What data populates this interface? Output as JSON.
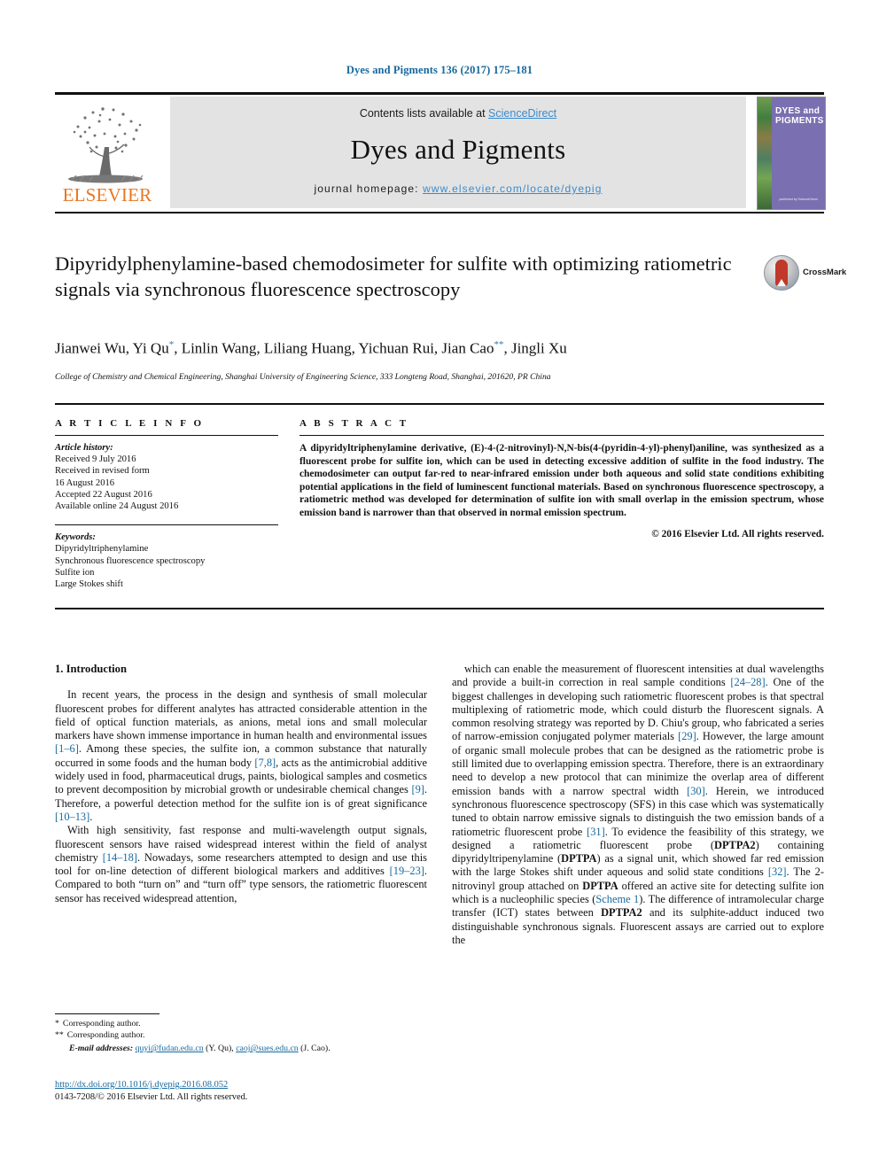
{
  "running_head": "Dyes and Pigments 136 (2017) 175–181",
  "masthead": {
    "contents_prefix": "Contents lists available at ",
    "contents_link": "ScienceDirect",
    "journal_name": "Dyes and Pigments",
    "homepage_prefix": "journal homepage: ",
    "homepage_url": "www.elsevier.com/locate/dyepig",
    "publisher_logo_text": "ELSEVIER",
    "cover_title": "DYES and PIGMENTS",
    "cover_footer": "published by ScienceDirect",
    "colors": {
      "link": "#3a8bcd",
      "elsevier_orange": "#e87722",
      "band_gray": "#e3e3e3",
      "cover_purple": "#7a6fb0"
    }
  },
  "crossmark": {
    "label": "CrossMark"
  },
  "title": "Dipyridylphenylamine-based chemodosimeter for sulfite with optimizing ratiometric signals via synchronous fluorescence spectroscopy",
  "authors_html": "Jianwei Wu, Yi Qu<sup>*</sup>, Linlin Wang, Liliang Huang, Yichuan Rui, Jian Cao<sup>**</sup>, Jingli Xu",
  "affiliation": "College of Chemistry and Chemical Engineering, Shanghai University of Engineering Science, 333 Longteng Road, Shanghai, 201620, PR China",
  "article_info": {
    "heading": "A R T I C L E   I N F O",
    "history_label": "Article history:",
    "history": [
      "Received 9 July 2016",
      "Received in revised form",
      "16 August 2016",
      "Accepted 22 August 2016",
      "Available online 24 August 2016"
    ],
    "keywords_label": "Keywords:",
    "keywords": [
      "Dipyridyltriphenylamine",
      "Synchronous fluorescence spectroscopy",
      "Sulfite ion",
      "Large Stokes shift"
    ]
  },
  "abstract": {
    "heading": "A B S T R A C T",
    "text": "A dipyridyltriphenylamine derivative, (E)-4-(2-nitrovinyl)-N,N-bis(4-(pyridin-4-yl)-phenyl)aniline, was synthesized as a fluorescent probe for sulfite ion, which can be used in detecting excessive addition of sulfite in the food industry. The chemodosimeter can output far-red to near-infrared emission under both aqueous and solid state conditions exhibiting potential applications in the field of luminescent functional materials. Based on synchronous fluorescence spectroscopy, a ratiometric method was developed for determination of sulfite ion with small overlap in the emission spectrum, whose emission band is narrower than that observed in normal emission spectrum.",
    "copyright": "© 2016 Elsevier Ltd. All rights reserved."
  },
  "body": {
    "section_number_title": "1.  Introduction",
    "left_paragraph_1_parts": [
      "In recent years, the process in the design and synthesis of small molecular fluorescent probes for different analytes has attracted considerable attention in the field of optical function materials, as anions, metal ions and small molecular markers have shown immense importance in human health and environmental issues ",
      "[1–6]",
      ". Among these species, the sulfite ion, a common substance that naturally occurred in some foods and the human body ",
      "[7,8]",
      ", acts as the antimicrobial additive widely used in food, pharmaceutical drugs, paints, biological samples and cosmetics to prevent decomposition by microbial growth or undesirable chemical changes ",
      "[9]",
      ". Therefore, a powerful detection method for the sulfite ion is of great significance ",
      "[10–13]",
      "."
    ],
    "left_paragraph_2_parts": [
      "With high sensitivity, fast response and multi-wavelength output signals, fluorescent sensors have raised widespread interest within the field of analyst chemistry ",
      "[14–18]",
      ". Nowadays, some researchers attempted to design and use this tool for on-line detection of different biological markers and additives ",
      "[19–23]",
      ". Compared to both “turn on” and “turn off” type sensors, the ratiometric fluorescent sensor has received widespread attention,"
    ],
    "right_paragraph_1_parts": [
      "which can enable the measurement of fluorescent intensities at dual wavelengths and provide a built-in correction in real sample conditions ",
      "[24–28]",
      ". One of the biggest challenges in developing such ratiometric fluorescent probes is that spectral multiplexing of ratiometric mode, which could disturb the fluorescent signals. A common resolving strategy was reported by D. Chiu's group, who fabricated a series of narrow-emission conjugated polymer materials ",
      "[29]",
      ". However, the large amount of organic small molecule probes that can be designed as the ratiometric probe is still limited due to overlapping emission spectra. Therefore, there is an extraordinary need to develop a new protocol that can minimize the overlap area of different emission bands with a narrow spectral width ",
      "[30]",
      ". Herein, we introduced synchronous fluorescence spectroscopy (SFS) in this case which was systematically tuned to obtain narrow emissive signals to distinguish the two emission bands of a ratiometric fluorescent probe ",
      "[31]",
      ". To evidence the feasibility of this strategy, we designed a ratiometric fluorescent probe (",
      "DPTPA2",
      ") containing dipyridyltripenylamine (",
      "DPTPA",
      ") as a signal unit, which showed far red emission with the large Stokes shift under aqueous and solid state conditions ",
      "[32]",
      ". The 2-nitrovinyl group attached on ",
      "DPTPA",
      " offered an active site for detecting sulfite ion which is a nucleophilic species (",
      "Scheme 1",
      "). The difference of intramolecular charge transfer (ICT) states between ",
      "DPTPA2",
      " and its sulphite-adduct induced two distinguishable synchronous signals. Fluorescent assays are carried out to explore the"
    ]
  },
  "footnotes": {
    "corresponding_1_mark": "*",
    "corresponding_1": "Corresponding author.",
    "corresponding_2_mark": "**",
    "corresponding_2": "Corresponding author.",
    "emails_label": "E-mail addresses:",
    "email_1": "quyi@fudan.edu.cn",
    "email_1_owner": "(Y. Qu)",
    "email_2": "caoj@sues.edu.cn",
    "email_2_owner": "(J. Cao)."
  },
  "doi_block": {
    "doi": "http://dx.doi.org/10.1016/j.dyepig.2016.08.052",
    "issn_line": "0143-7208/© 2016 Elsevier Ltd. All rights reserved."
  }
}
